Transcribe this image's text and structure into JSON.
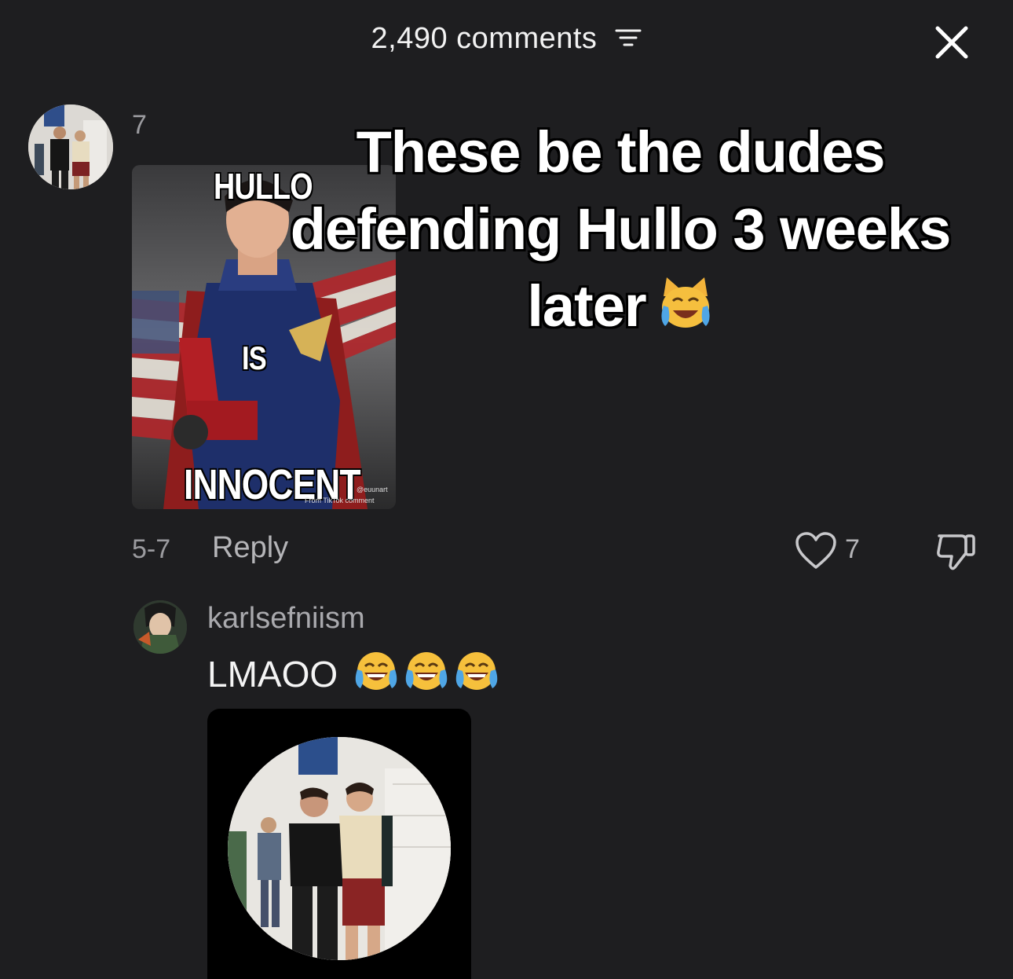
{
  "header": {
    "comment_count": "2,490 comments",
    "filter_icon": "filter-lines-icon",
    "close_icon": "close-icon"
  },
  "comments": [
    {
      "username": "7",
      "meme": {
        "top_text": "HULLO",
        "middle_text": "IS",
        "bottom_text": "INNOCENT",
        "credit_handle": "@euunart",
        "credit_source": "From TikTok comment"
      },
      "date": "5-7",
      "reply_label": "Reply",
      "like_count": "7"
    },
    {
      "username": "karlsefniism",
      "text": "LMAOO",
      "emojis": [
        "face-with-tears-of-joy",
        "face-with-tears-of-joy",
        "face-with-tears-of-joy"
      ]
    }
  ],
  "overlay": {
    "caption": "These be the dudes defending Hullo 3 weeks later",
    "emoji": "cat-with-tears-of-joy"
  },
  "colors": {
    "background": "#1e1e20",
    "muted_text": "#9b9b9f",
    "primary_text": "#ffffff"
  }
}
